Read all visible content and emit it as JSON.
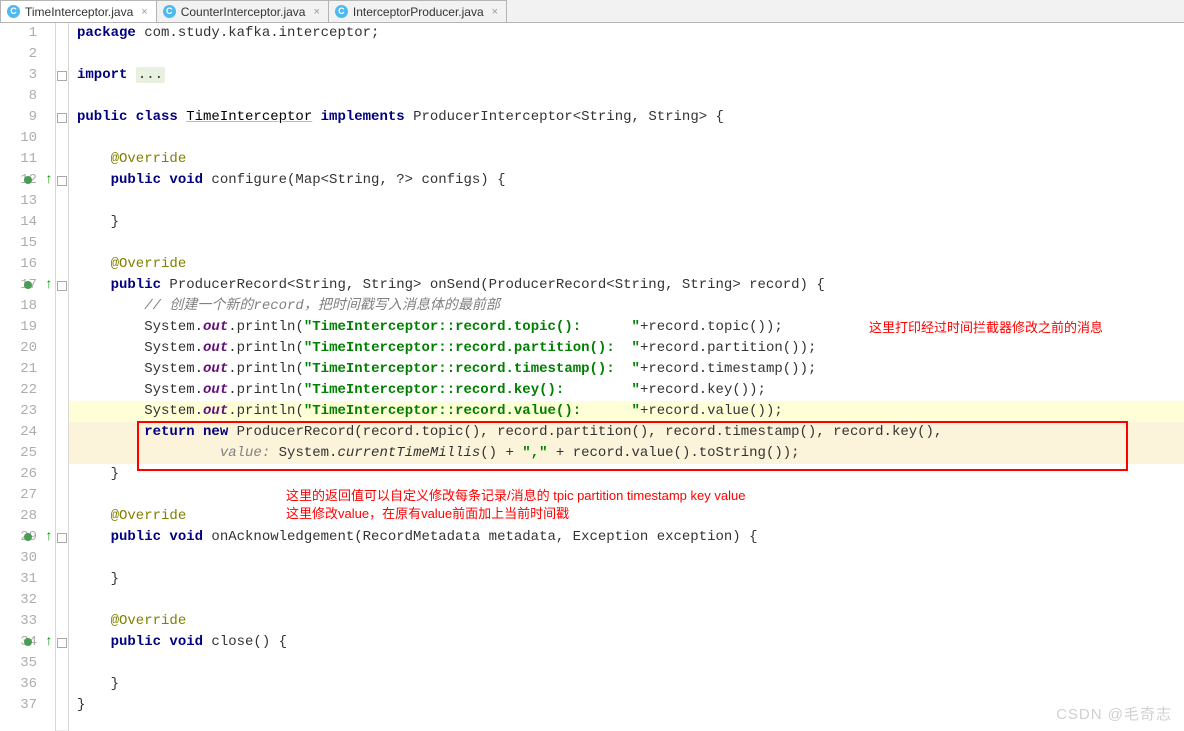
{
  "tabs": [
    {
      "label": "TimeInterceptor.java",
      "icon": "C"
    },
    {
      "label": "CounterInterceptor.java",
      "icon": "C"
    },
    {
      "label": "InterceptorProducer.java",
      "icon": "C"
    }
  ],
  "line_numbers": [
    "1",
    "2",
    "3",
    "8",
    "9",
    "10",
    "11",
    "12",
    "13",
    "14",
    "15",
    "16",
    "17",
    "18",
    "19",
    "20",
    "21",
    "22",
    "23",
    "24",
    "25",
    "26",
    "27",
    "28",
    "29",
    "30",
    "31",
    "32",
    "33",
    "34",
    "35",
    "36",
    "37"
  ],
  "lines": {
    "l1_pre": "package ",
    "l1_pkg": "com.study.kafka.interceptor;",
    "l3_pre": "import ",
    "l3_ell": "...",
    "l9a": "public class ",
    "l9b": "TimeInterceptor",
    "l9c": " implements ",
    "l9d": "ProducerInterceptor<String, String> {",
    "l11": "    @Override",
    "l12a": "    public void ",
    "l12b": "configure(Map<String, ?> configs) {",
    "l14": "    }",
    "l16": "    @Override",
    "l17a": "    public ",
    "l17b": "ProducerRecord<String, String> onSend(ProducerRecord<String, String> record) {",
    "l18": "        // 创建一个新的record，把时间戳写入消息体的最前部",
    "l19a": "        System.",
    "l19o": "out",
    "l19b": ".println(",
    "l19s": "\"TimeInterceptor::record.topic():      \"",
    "l19c": "+record.topic());",
    "l20a": "        System.",
    "l20o": "out",
    "l20b": ".println(",
    "l20s": "\"TimeInterceptor::record.partition():  \"",
    "l20c": "+record.partition());",
    "l21a": "        System.",
    "l21o": "out",
    "l21b": ".println(",
    "l21s": "\"TimeInterceptor::record.timestamp():  \"",
    "l21c": "+record.timestamp());",
    "l22a": "        System.",
    "l22o": "out",
    "l22b": ".println(",
    "l22s": "\"TimeInterceptor::record.key():        \"",
    "l22c": "+record.key());",
    "l23a": "        System.",
    "l23o": "out",
    "l23b": ".println(",
    "l23s": "\"TimeInterceptor::record.value():      \"",
    "l23c": "+record.value());",
    "l24a": "        return new ",
    "l24b": "ProducerRecord(record.topic(), record.partition(), record.timestamp(), record.key(),",
    "l25p": "                 value: ",
    "l25a": "System.",
    "l25m": "currentTimeMillis",
    "l25b": "() + ",
    "l25s": "\",\"",
    "l25c": " + record.value().toString());",
    "l26": "    }",
    "l28": "    @Override",
    "l29a": "    public void ",
    "l29b": "onAcknowledgement(RecordMetadata metadata, Exception exception) {",
    "l31": "    }",
    "l33": "    @Override",
    "l34a": "    public void ",
    "l34b": "close() {",
    "l36": "    }",
    "l37": "}"
  },
  "notes": {
    "n1": "这里打印经过时间拦截器修改之前的消息",
    "n2": "这里的返回值可以自定义修改每条记录/消息的 tpic partition timestamp key value",
    "n3": "这里修改value，在原有value前面加上当前时间戳"
  },
  "watermark": "CSDN @毛奇志"
}
